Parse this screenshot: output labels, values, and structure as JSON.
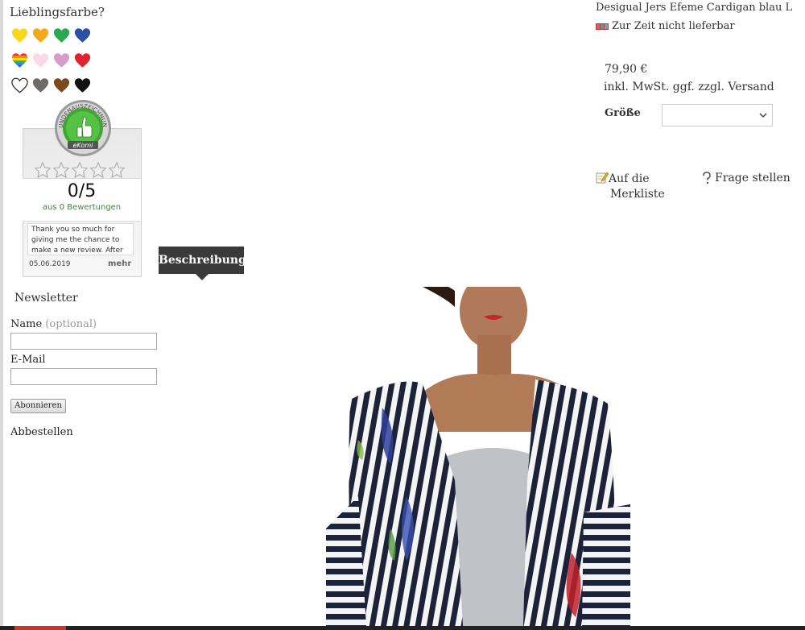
{
  "sidebar": {
    "fav_title": "Lieblingsfarbe?",
    "hearts": [
      [
        "#f7d81e",
        "#f3a81d",
        "#2aa751",
        "#2c4fa3"
      ],
      [
        "rainbow",
        "#f9d9e6",
        "#d89ccc",
        "#e3222f"
      ],
      [
        "#ffffff",
        "#6e6a64",
        "#7a4a1e",
        "#111111"
      ]
    ],
    "ekomi": {
      "seal_top": "KUNDENAUSZEICHNUNG",
      "seal_brand": "eKomi",
      "score": "0/5",
      "score_sub": "aus 0 Bewertungen",
      "review_text": "Thank you so much for giving me the chance to make a new review. After",
      "review_date": "05.06.2019",
      "review_more": "mehr"
    },
    "newsletter": {
      "title": "Newsletter",
      "name_label": "Name",
      "name_optional": "(optional)",
      "name_value": "",
      "email_label": "E-Mail",
      "email_value": "",
      "subscribe": "Abonnieren",
      "unsubscribe": "Abbestellen"
    }
  },
  "tabs": {
    "description": "Beschreibung"
  },
  "product": {
    "title": "Desigual Jers Efeme Cardigan blau L",
    "availability": "Zur Zeit nicht lieferbar",
    "price": "79,90 €",
    "price_note": "inkl. MwSt. ggf. zzgl. Versand",
    "size_label": "Größe",
    "size_value": "",
    "wishlist_line1": "Auf die",
    "wishlist_line2": "Merkliste",
    "ask_question": "Frage stellen"
  },
  "icons": {
    "availability": "red-status-icon",
    "wishlist": "pencil-note-icon",
    "ask": "question-icon",
    "select": "chevron-down-icon"
  }
}
